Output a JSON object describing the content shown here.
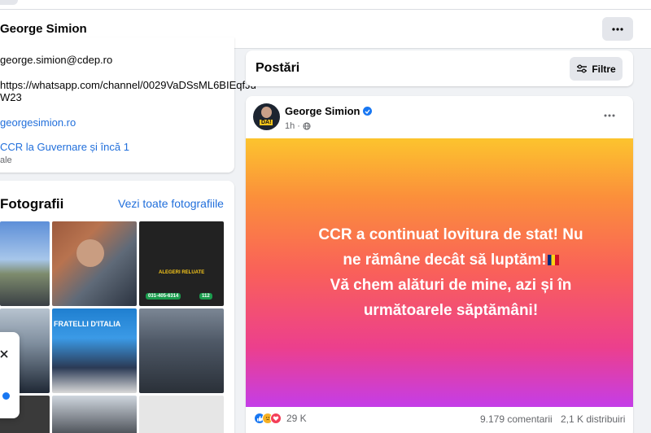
{
  "header": {
    "title": "George Simion"
  },
  "about": {
    "email": "george.simion@cdep.ro",
    "whatsapp_line1": "https://whatsapp.com/channel/0029VaDSsML6BIEqfJu",
    "whatsapp_line2": "W23",
    "website": "georgesimion.ro",
    "links_line": "CCR la Guvernare și încă 1",
    "links_sub": "ale"
  },
  "photos": {
    "title": "Fotografii",
    "see_all": "Vezi toate fotografiile",
    "thumb_texts": {
      "poster_title": "ALEGERI RELUATE",
      "poster_phone1": "031-405-6314",
      "poster_phone2": "112",
      "fratelli_text": "FRATELLI D'ITALIA"
    }
  },
  "posts_header": {
    "title": "Postări",
    "filter_label": "Filtre"
  },
  "post": {
    "author": "George Simion",
    "time": "1h",
    "avatar_text": "DA!",
    "banner_line1": "CCR a continuat lovitura de stat! Nu",
    "banner_line2": "ne rămâne decât să luptăm!",
    "banner_line3": "Vă chem alături de mine, azi și în",
    "banner_line4": "următoarele săptămâni!",
    "reactions_count": "29 K",
    "comments": "9.179 comentarii",
    "shares": "2,1 K distribuiri"
  },
  "colors": {
    "accent": "#1877f2",
    "link": "#216fdb",
    "banner_top": "#fcc42e",
    "banner_bottom": "#c43de8"
  },
  "icons": [
    "more-icon",
    "filter-icon",
    "verified-icon",
    "globe-icon",
    "like-reaction-icon",
    "sad-reaction-icon",
    "love-reaction-icon",
    "close-icon"
  ]
}
